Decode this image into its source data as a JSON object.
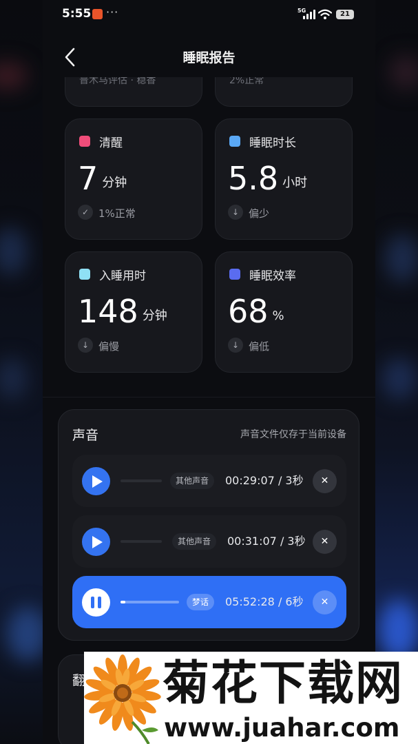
{
  "status_bar": {
    "time": "5:55",
    "more": "···",
    "signal_label": "5G",
    "battery": "21"
  },
  "header": {
    "title": "睡眠报告",
    "back_icon": "chevron-left-icon"
  },
  "top_cut_cards": [
    {
      "text": "普木马评估 · 稳香"
    },
    {
      "text": "2%正常"
    }
  ],
  "stats": [
    {
      "label": "清醒",
      "value": "7",
      "unit": "分钟",
      "hint": "1%正常",
      "hint_icon": "check-circle-icon",
      "hint_glyph": "✓",
      "color": "#f04d7a"
    },
    {
      "label": "睡眠时长",
      "value": "5.8",
      "unit": "小时",
      "hint": "偏少",
      "hint_icon": "arrow-down-circle-icon",
      "hint_glyph": "↓",
      "color": "#5aa8f5"
    },
    {
      "label": "入睡用时",
      "value": "148",
      "unit": "分钟",
      "hint": "偏慢",
      "hint_icon": "arrow-down-circle-icon",
      "hint_glyph": "↓",
      "color": "#8fe0f5"
    },
    {
      "label": "睡眠效率",
      "value": "68",
      "unit": "%",
      "hint": "偏低",
      "hint_icon": "arrow-down-circle-icon",
      "hint_glyph": "↓",
      "color": "#5a6cf0"
    }
  ],
  "sound": {
    "title": "声音",
    "note": "声音文件仅存于当前设备",
    "recordings": [
      {
        "tag": "其他声音",
        "time": "00:29:07 / 3秒",
        "state": "stopped",
        "progress": 0,
        "close": "✕"
      },
      {
        "tag": "其他声音",
        "time": "00:31:07 / 3秒",
        "state": "stopped",
        "progress": 0,
        "close": "✕"
      },
      {
        "tag": "梦话",
        "time": "05:52:28 / 6秒",
        "state": "playing",
        "progress": 0.08,
        "close": "✕"
      }
    ]
  },
  "next_section": {
    "title": "翻"
  },
  "watermark": {
    "main": "菊花下载网",
    "sub": "www.juahar.com"
  },
  "colors": {
    "accent": "#2f6ff5",
    "card_bg": "#17181d",
    "screen_bg": "#0c0d11"
  }
}
